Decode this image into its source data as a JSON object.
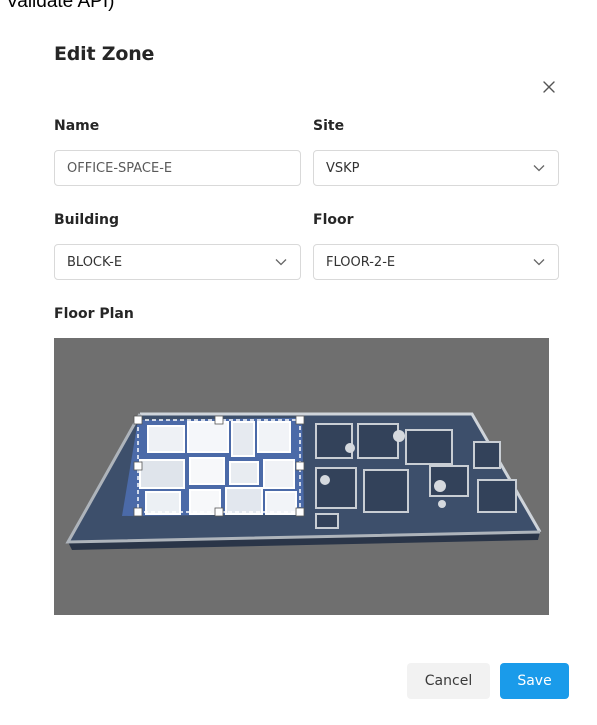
{
  "background": {
    "cut_text": "Validate API)"
  },
  "dialog": {
    "title": "Edit Zone",
    "close_icon": "close-icon"
  },
  "form": {
    "name": {
      "label": "Name",
      "value": "OFFICE-SPACE-E"
    },
    "site": {
      "label": "Site",
      "value": "VSKP"
    },
    "building": {
      "label": "Building",
      "value": "BLOCK-E"
    },
    "floor": {
      "label": "Floor",
      "value": "FLOOR-2-E"
    },
    "floor_plan": {
      "label": "Floor Plan"
    }
  },
  "footer": {
    "cancel_label": "Cancel",
    "save_label": "Save"
  },
  "colors": {
    "accent": "#1a9bea",
    "plan_background": "#6f6f6f",
    "selection_border": "#ffffff"
  }
}
